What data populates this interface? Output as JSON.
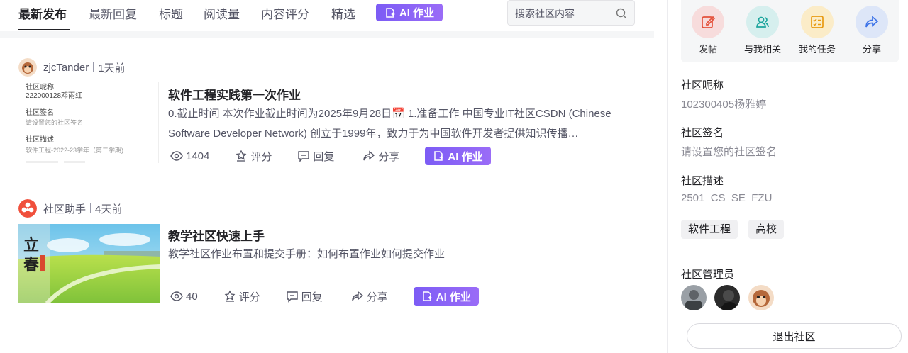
{
  "tabs": [
    {
      "label": "最新发布",
      "active": true
    },
    {
      "label": "最新回复"
    },
    {
      "label": "标题"
    },
    {
      "label": "阅读量"
    },
    {
      "label": "内容评分"
    },
    {
      "label": "精选"
    }
  ],
  "ai_tab_label": "AI 作业",
  "search": {
    "placeholder": "搜索社区内容"
  },
  "posts": [
    {
      "author": "zjcTander",
      "time": "1天前",
      "title": "软件工程实践第一次作业",
      "desc": " 0.截止时间 本次作业截止时间为2025年9月28日📅 1.准备工作 中国专业IT社区CSDN (Chinese Software Developer Network) 创立于1999年，致力于为中国软件开发者提供知识传播…",
      "views": "1404",
      "rate": "评分",
      "reply": "回复",
      "share": "分享",
      "ai": "AI 作业",
      "thumb": {
        "l1": "社区昵称",
        "v1": "222000128邓雨红",
        "l2": "社区签名",
        "v2": "请设置您的社区签名",
        "l3": "社区描述",
        "v3": "软件工程-2022-23学年（第二学期)"
      }
    },
    {
      "author": "社区助手",
      "time": "4天前",
      "title": "教学社区快速上手",
      "desc": "教学社区作业布置和提交手册：如何布置作业如何提交作业",
      "views": "40",
      "rate": "评分",
      "reply": "回复",
      "share": "分享",
      "ai": "AI 作业",
      "thumb": {
        "t1": "立",
        "t2": "春"
      }
    }
  ],
  "quick_actions": [
    {
      "label": "发帖",
      "icon": "edit-icon",
      "color": "#f7dcdc"
    },
    {
      "label": "与我相关",
      "icon": "users-icon",
      "color": "#d6efee"
    },
    {
      "label": "我的任务",
      "icon": "task-icon",
      "color": "#fbecc8"
    },
    {
      "label": "分享",
      "icon": "share-icon",
      "color": "#dde6f8"
    }
  ],
  "sidebar": {
    "nickname_label": "社区昵称",
    "nickname_value": "102300405杨雅婷",
    "signature_label": "社区签名",
    "signature_value": "请设置您的社区签名",
    "desc_label": "社区描述",
    "desc_value": "2501_CS_SE_FZU",
    "tags": [
      "软件工程",
      "高校"
    ],
    "admins_label": "社区管理员",
    "exit_label": "退出社区"
  },
  "colors": {
    "ai_purple": "#7c5cf5",
    "text_primary": "#222226",
    "text_secondary": "#555666"
  }
}
